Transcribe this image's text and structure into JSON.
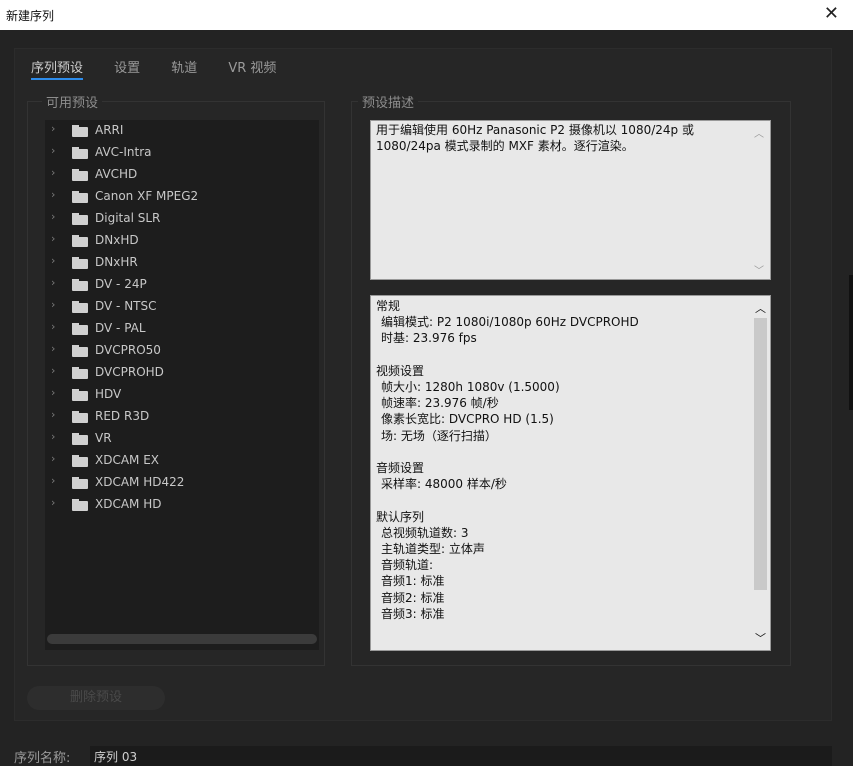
{
  "window": {
    "title": "新建序列",
    "close_glyph": "✕"
  },
  "tabs": [
    "序列预设",
    "设置",
    "轨道",
    "VR 视频"
  ],
  "presets": {
    "label": "可用预设",
    "items": [
      "ARRI",
      "AVC-Intra",
      "AVCHD",
      "Canon XF MPEG2",
      "Digital SLR",
      "DNxHD",
      "DNxHR",
      "DV - 24P",
      "DV - NTSC",
      "DV - PAL",
      "DVCPRO50",
      "DVCPROHD",
      "HDV",
      "RED R3D",
      "VR",
      "XDCAM EX",
      "XDCAM HD422",
      "XDCAM HD"
    ]
  },
  "description": {
    "label": "预设描述",
    "line1": "用于编辑使用 60Hz Panasonic P2 摄像机以 1080/24p 或",
    "line2": "1080/24pa 模式录制的 MXF 素材。逐行渲染。"
  },
  "details": {
    "general_header": "常规",
    "edit_mode": "编辑模式: P2 1080i/1080p 60Hz DVCPROHD",
    "timebase": "时基: 23.976 fps",
    "video_header": "视频设置",
    "frame_size": "帧大小: 1280h 1080v (1.5000)",
    "frame_rate": "帧速率: 23.976  帧/秒",
    "pixel_aspect": "像素长宽比: DVCPRO HD (1.5)",
    "fields": "场: 无场（逐行扫描）",
    "audio_header": "音频设置",
    "sample_rate": "采样率: 48000 样本/秒",
    "default_header": "默认序列",
    "total_tracks": "总视频轨道数: 3",
    "master_type": "主轨道类型: 立体声",
    "audio_tracks": "音频轨道:",
    "a1": "音频1: 标准",
    "a2": "音频2: 标准",
    "a3": "音频3: 标准"
  },
  "delete_button": "删除预设",
  "sequence_name": {
    "label": "序列名称:",
    "value": "序列 03"
  },
  "colors": {
    "accent": "#2d8ceb",
    "bg": "#232323",
    "panel": "#262626"
  }
}
